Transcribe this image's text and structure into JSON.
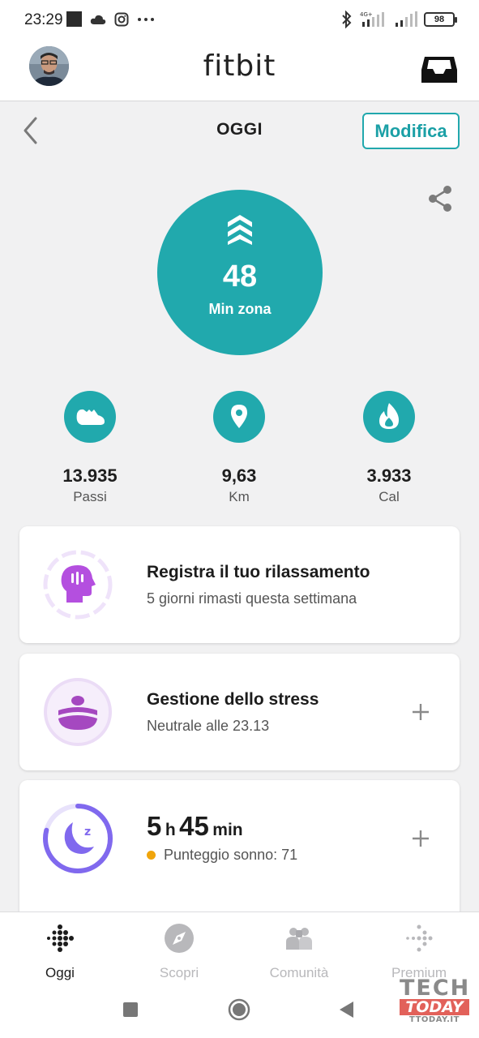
{
  "status_bar": {
    "time": "23:29",
    "battery": "98",
    "network": "4G+"
  },
  "app_bar": {
    "logo": "fitbit"
  },
  "day_header": {
    "title": "OGGI",
    "edit_label": "Modifica"
  },
  "hero": {
    "value": "48",
    "label": "Min zona",
    "icon": "active-zone-chevrons-icon"
  },
  "stats": [
    {
      "value": "13.935",
      "label": "Passi",
      "icon": "shoe-icon"
    },
    {
      "value": "9,63",
      "label": "Km",
      "icon": "location-pin-icon"
    },
    {
      "value": "3.933",
      "label": "Cal",
      "icon": "flame-icon"
    }
  ],
  "cards": {
    "relax": {
      "title": "Registra il tuo rilassamento",
      "subtitle": "5 giorni rimasti questa settimana"
    },
    "stress": {
      "title": "Gestione dello stress",
      "subtitle": "Neutrale alle 23.13"
    },
    "sleep": {
      "hours": "5",
      "hours_unit": "h",
      "minutes": "45",
      "minutes_unit": "min",
      "score_text": "Punteggio sonno: 71",
      "progress": 0.79
    }
  },
  "bottom_nav": [
    {
      "label": "Oggi",
      "active": true
    },
    {
      "label": "Scopri",
      "active": false
    },
    {
      "label": "Comunità",
      "active": false
    },
    {
      "label": "Premium",
      "active": false
    }
  ],
  "watermark": {
    "line1": "TECH",
    "line2": "TODAY",
    "line3": "TTODAY.IT"
  },
  "colors": {
    "accent": "#21a9ad",
    "purple": "#9b4fd8",
    "sleep_purple": "#8069ee",
    "score_dot": "#f0a50c"
  }
}
